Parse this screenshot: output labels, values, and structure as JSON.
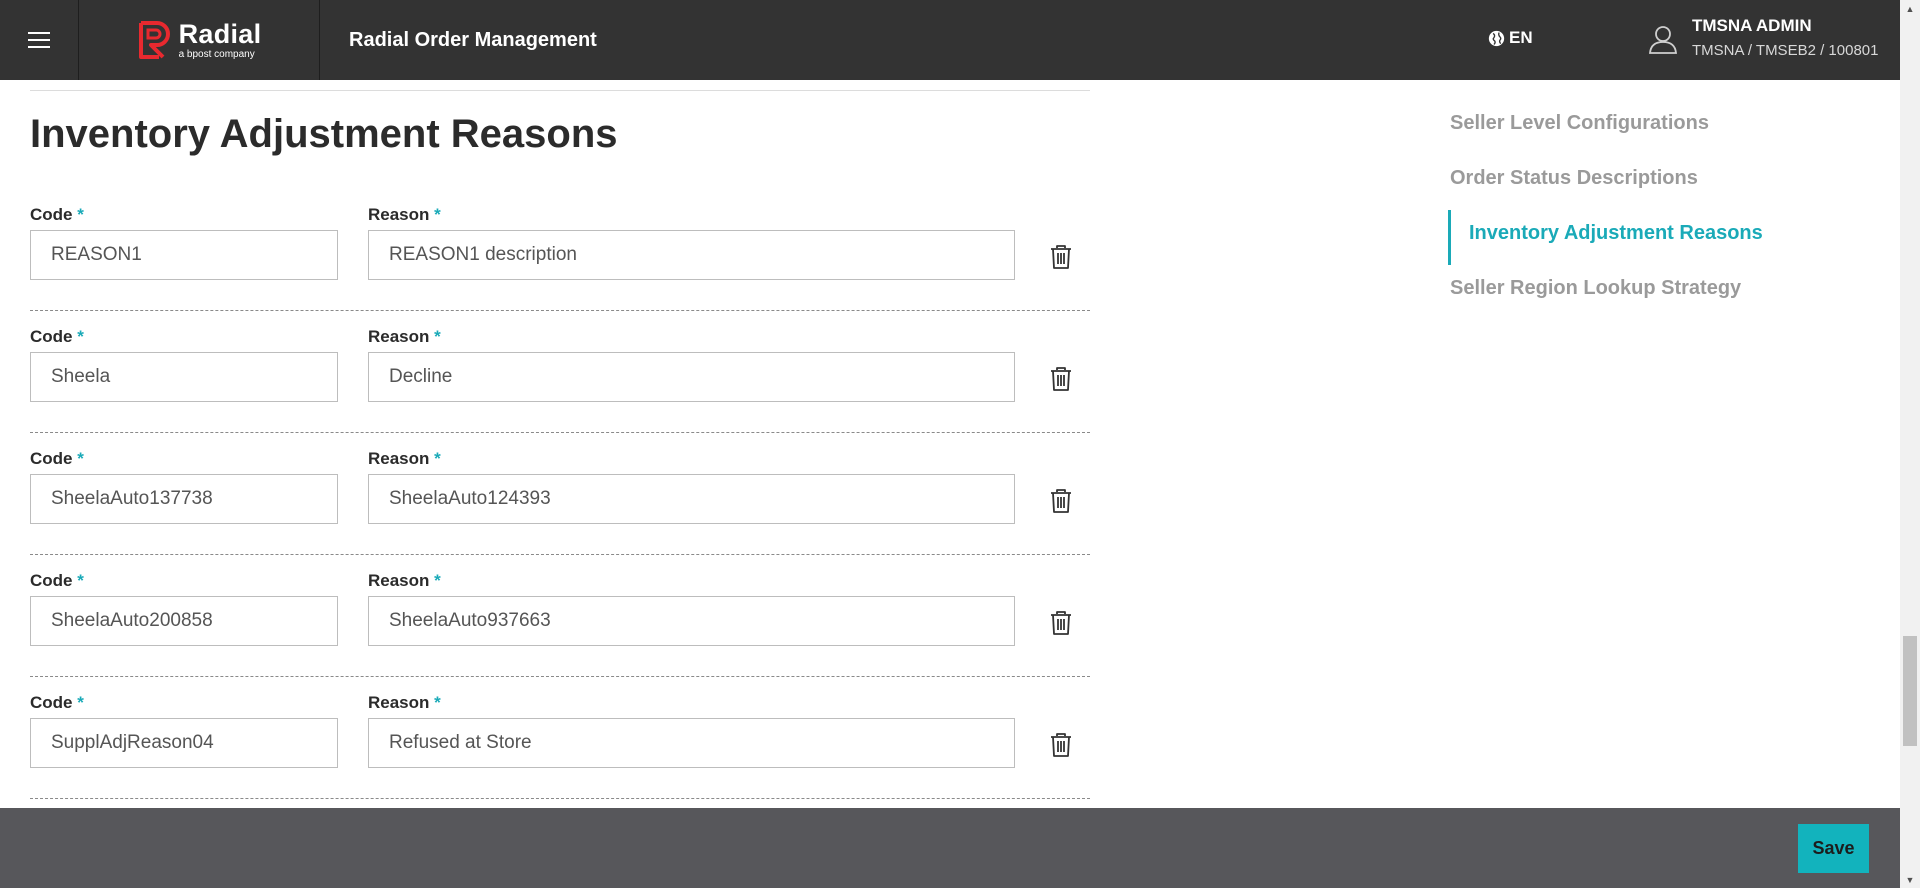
{
  "header": {
    "brand_name": "Radial",
    "brand_tagline": "a bpost company",
    "app_title": "Radial Order Management",
    "language": "EN",
    "user_name": "TMSNA ADMIN",
    "user_path": "TMSNA / TMSEB2 / 100801"
  },
  "main": {
    "title": "Inventory Adjustment Reasons",
    "code_label": "Code",
    "reason_label": "Reason",
    "required_mark": "*",
    "rows": [
      {
        "code": "REASON1",
        "reason": "REASON1 description"
      },
      {
        "code": "Sheela",
        "reason": "Decline"
      },
      {
        "code": "SheelaAuto137738",
        "reason": "SheelaAuto124393"
      },
      {
        "code": "SheelaAuto200858",
        "reason": "SheelaAuto937663"
      },
      {
        "code": "SupplAdjReason04",
        "reason": "Refused at Store"
      }
    ]
  },
  "side_nav": {
    "items": [
      {
        "label": "Seller Level Configurations",
        "active": false
      },
      {
        "label": "Order Status Descriptions",
        "active": false
      },
      {
        "label": "Inventory Adjustment Reasons",
        "active": true
      },
      {
        "label": "Seller Region Lookup Strategy",
        "active": false
      }
    ]
  },
  "footer": {
    "save_label": "Save"
  },
  "colors": {
    "accent": "#1aaab8",
    "header_bg": "#333333",
    "footer_bg": "#57575b",
    "save_button": "#12b3bd"
  },
  "icons": [
    "hamburger-icon",
    "radial-logo-icon",
    "globe-icon",
    "user-icon",
    "trash-icon"
  ]
}
